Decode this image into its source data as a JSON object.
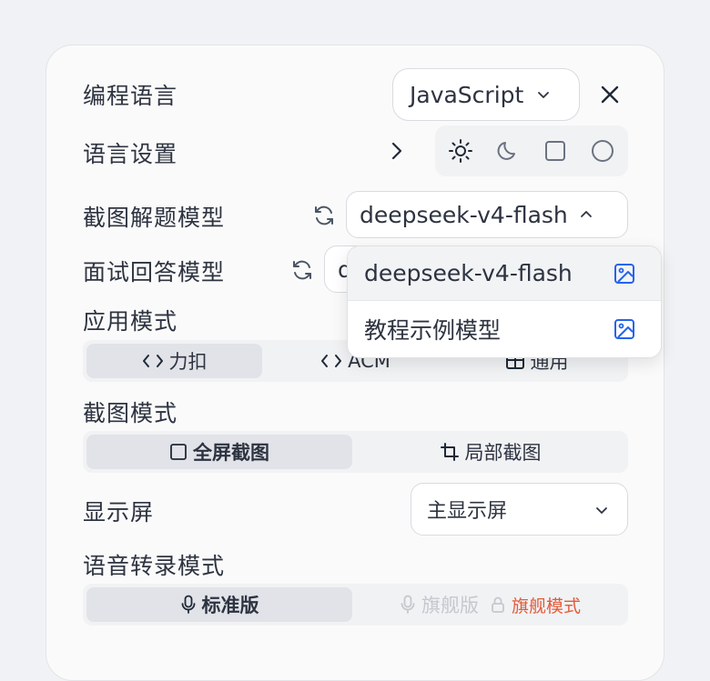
{
  "settings": {
    "language_label": "编程语言",
    "language_value": "JavaScript",
    "language_settings_label": "语言设置",
    "screenshot_model_label": "截图解题模型",
    "screenshot_model_value": "deepseek-v4-flash",
    "interview_model_label": "面试回答模型",
    "interview_model_value": "deepseek-v4-flash",
    "app_mode_label": "应用模式",
    "app_modes": [
      "力扣",
      "ACM",
      "通用"
    ],
    "capture_mode_label": "截图模式",
    "capture_modes": [
      "全屏截图",
      "局部截图"
    ],
    "display_label": "显示屏",
    "display_value": "主显示屏",
    "transcribe_label": "语音转录模式",
    "transcribe_modes": [
      "标准版",
      "旗舰版"
    ],
    "flagship_badge": "旗舰模式"
  },
  "dropdown": {
    "items": [
      "deepseek-v4-flash",
      "教程示例模型"
    ]
  },
  "colors": {
    "accent": "#2563eb",
    "flagship": "#e25b3a",
    "text": "#2d3340"
  }
}
